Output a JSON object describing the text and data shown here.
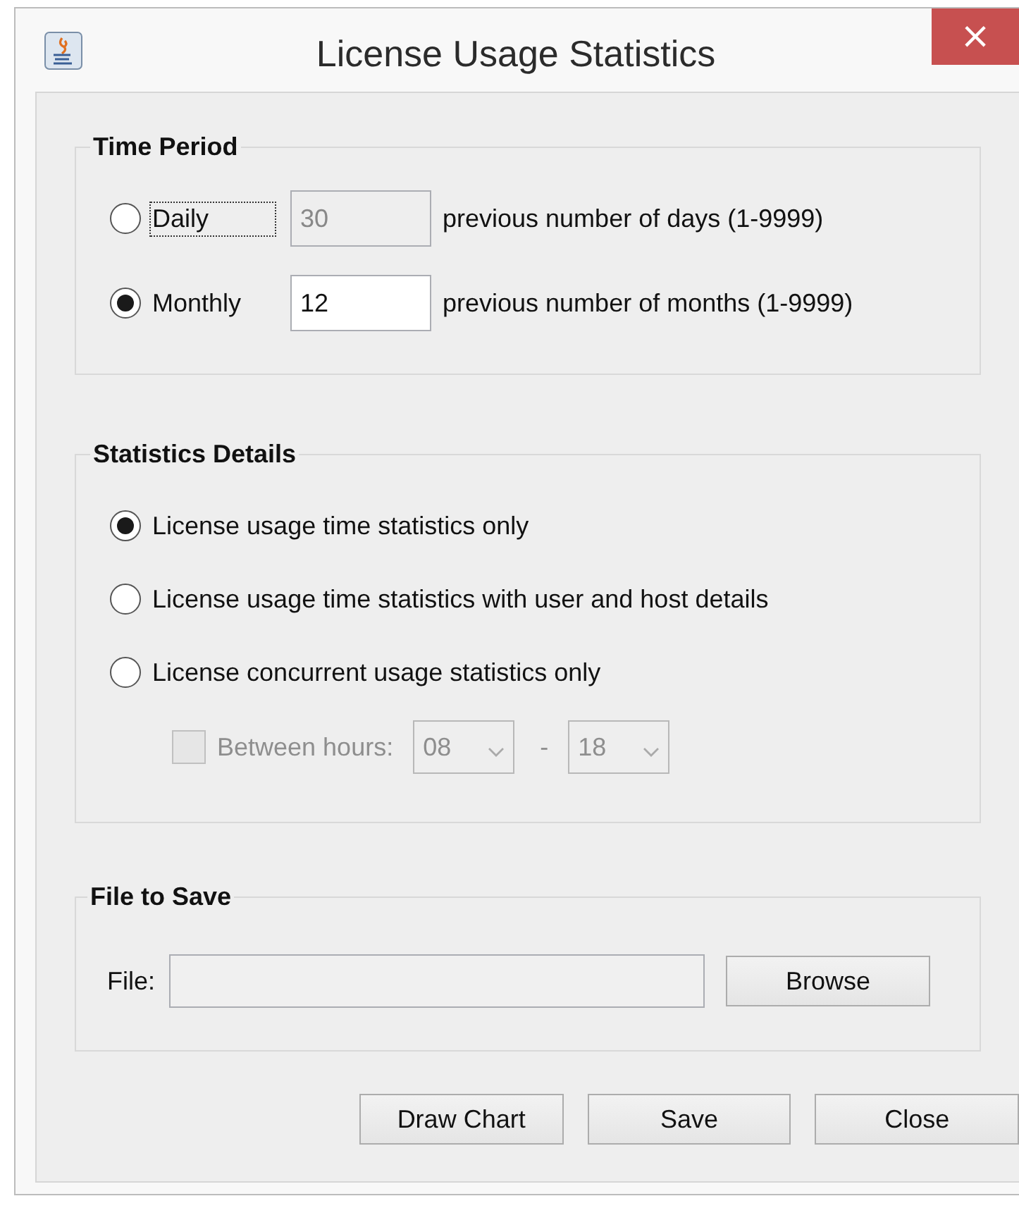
{
  "window": {
    "title": "License Usage Statistics",
    "close": "×"
  },
  "time_period": {
    "title": "Time Period",
    "options": [
      {
        "label": "Daily",
        "selected": false,
        "focused": true,
        "value": "30",
        "disabled": true,
        "suffix": "previous number of days (1-9999)"
      },
      {
        "label": "Monthly",
        "selected": true,
        "focused": false,
        "value": "12",
        "disabled": false,
        "suffix": "previous number of months (1-9999)"
      }
    ]
  },
  "statistics_details": {
    "title": "Statistics Details",
    "options": [
      {
        "label": "License usage time statistics only",
        "selected": true
      },
      {
        "label": "License usage time statistics with user and host details",
        "selected": false
      },
      {
        "label": "License concurrent usage statistics only",
        "selected": false
      }
    ],
    "between_hours": {
      "label": "Between hours:",
      "checked": false,
      "disabled": true,
      "from": "08",
      "separator": "-",
      "to": "18"
    }
  },
  "file_to_save": {
    "title": "File to Save",
    "label": "File:",
    "browse": "Browse"
  },
  "buttons": [
    "Draw Chart",
    "Save",
    "Close"
  ]
}
